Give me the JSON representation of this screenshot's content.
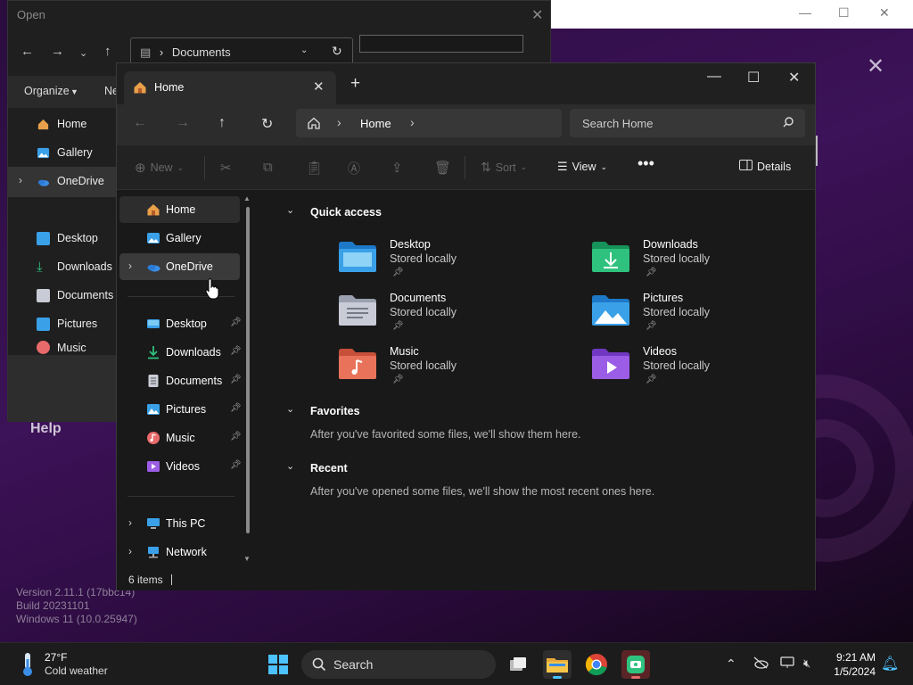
{
  "open_dialog": {
    "title": "Open",
    "path": "Documents",
    "toolbar": {
      "organize": "Organize",
      "new_folder": "Ne"
    },
    "nav_items": [
      {
        "label": "Home"
      },
      {
        "label": "Gallery"
      },
      {
        "label": "OneDrive"
      },
      {
        "label": "Desktop"
      },
      {
        "label": "Downloads"
      },
      {
        "label": "Documents"
      },
      {
        "label": "Pictures"
      },
      {
        "label": "Music"
      }
    ]
  },
  "background_app": {
    "help_label": "Help",
    "version_lines": [
      "Version 2.11.1 (17bbc14)",
      "Build 20231101",
      "Windows 11 (10.0.25947)"
    ]
  },
  "explorer": {
    "tab_label": "Home",
    "breadcrumb_location": "Home",
    "search_placeholder": "Search Home",
    "commands": {
      "new": "New",
      "sort": "Sort",
      "view": "View",
      "details": "Details"
    },
    "nav_pane": {
      "top": [
        {
          "label": "Home",
          "icon": "home-icon"
        },
        {
          "label": "Gallery",
          "icon": "gallery-icon"
        },
        {
          "label": "OneDrive",
          "icon": "onedrive-icon"
        }
      ],
      "pinned": [
        {
          "label": "Desktop",
          "icon": "desktop-folder-icon",
          "color": "#3aa0e8"
        },
        {
          "label": "Downloads",
          "icon": "downloads-folder-icon",
          "color": "#2ec27e"
        },
        {
          "label": "Documents",
          "icon": "documents-folder-icon",
          "color": "#c9ccd6"
        },
        {
          "label": "Pictures",
          "icon": "pictures-folder-icon",
          "color": "#3aa0e8"
        },
        {
          "label": "Music",
          "icon": "music-folder-icon",
          "color": "#e86a6a"
        },
        {
          "label": "Videos",
          "icon": "videos-folder-icon",
          "color": "#9b5de5"
        }
      ],
      "bottom": [
        {
          "label": "This PC",
          "icon": "this-pc-icon"
        },
        {
          "label": "Network",
          "icon": "network-icon"
        }
      ]
    },
    "quick_access": {
      "header": "Quick access",
      "items": [
        {
          "name": "Desktop",
          "status": "Stored locally",
          "color": "#3aa0e8"
        },
        {
          "name": "Downloads",
          "status": "Stored locally",
          "color": "#2ec27e"
        },
        {
          "name": "Documents",
          "status": "Stored locally",
          "color": "#c9ccd6"
        },
        {
          "name": "Pictures",
          "status": "Stored locally",
          "color": "#3aa0e8"
        },
        {
          "name": "Music",
          "status": "Stored locally",
          "color": "#e8735a"
        },
        {
          "name": "Videos",
          "status": "Stored locally",
          "color": "#9b5de5"
        }
      ]
    },
    "favorites": {
      "header": "Favorites",
      "note": "After you've favorited some files, we'll show them here."
    },
    "recent": {
      "header": "Recent",
      "note": "After you've opened some files, we'll show the most recent ones here."
    },
    "status": "6 items"
  },
  "taskbar": {
    "weather_temp": "27°F",
    "weather_desc": "Cold weather",
    "search_label": "Search",
    "time": "9:21 AM",
    "date": "1/5/2024"
  }
}
